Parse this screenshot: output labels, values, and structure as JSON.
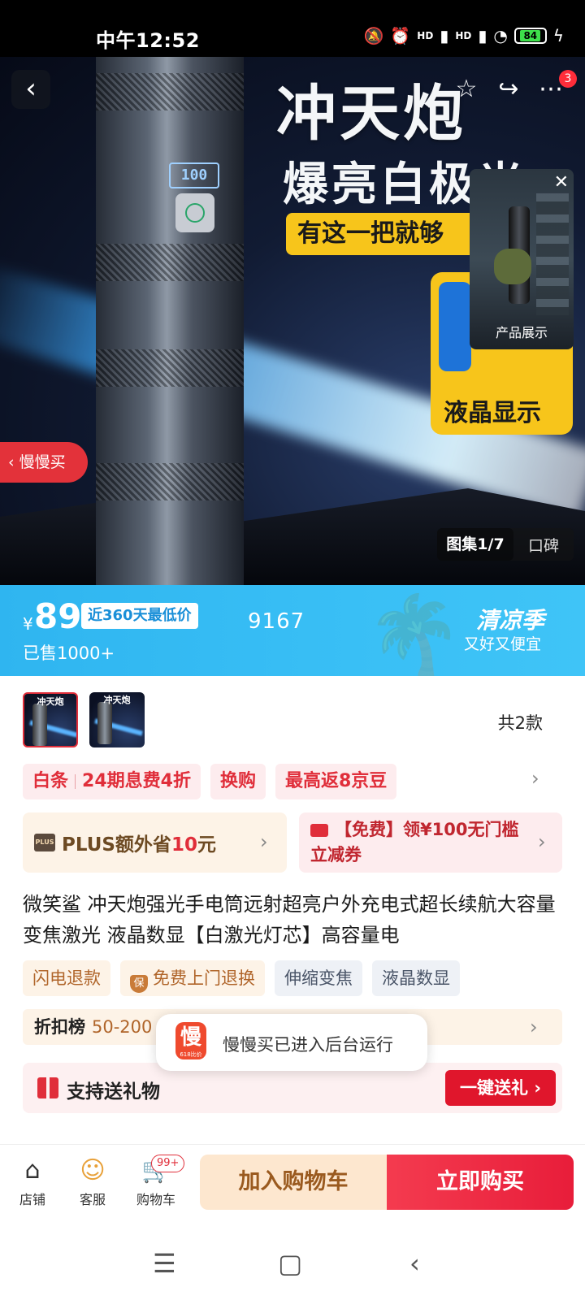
{
  "status_bar": {
    "time": "中午12:52",
    "sig1": "HD",
    "sig2": "HD",
    "battery": "84"
  },
  "hero": {
    "headline1": "冲天炮",
    "headline2": "爆亮白极光",
    "tag_yellow": "有这一把就够",
    "lcd_label": "液晶显示",
    "screen_readout": "100",
    "badge_count": "3",
    "video_caption": "产品展示",
    "manman_label": "慢慢买",
    "gallery": "图集1/7",
    "reviews": "口碑"
  },
  "price": {
    "currency": "¥",
    "value": "89",
    "lowest_label": "近360天最低价",
    "sold": "已售1000+",
    "code": "9167",
    "season_title": "清凉季",
    "season_sub": "又好又便宜"
  },
  "variants": {
    "thumb_text": "冲天炮",
    "count_label": "共2款"
  },
  "promos": [
    {
      "left": "白条",
      "right": "24期息费4折"
    },
    {
      "label": "换购"
    },
    {
      "label": "最高返8京豆"
    }
  ],
  "coupons": {
    "plus_logo": "PLUS",
    "plus_text": "PLUS额外省",
    "plus_amount": "10",
    "plus_unit": "元",
    "free_text": "【免费】领¥100无门槛立减券"
  },
  "product_title": "微笑鲨 冲天炮强光手电筒远射超亮户外充电式超长续航大容量变焦激光 液晶数显【白激光灯芯】高容量电",
  "service_tags": [
    "闪电退款",
    "免费上门退换",
    "伸缩变焦",
    "液晶数显"
  ],
  "rank": {
    "label": "折扣榜",
    "value": "50-200"
  },
  "toast": {
    "logo": "慢",
    "logo_sub": "618比价",
    "message": "慢慢买已进入后台运行"
  },
  "gift": {
    "label": "支持送礼物",
    "button": "一键送礼 ›"
  },
  "bottom_bar": {
    "shop": "店铺",
    "service": "客服",
    "cart": "购物车",
    "cart_badge": "99+",
    "add_to_cart": "加入购物车",
    "buy_now": "立即购买"
  },
  "colors": {
    "accent_red": "#e02e3a",
    "price_blue": "#2fb5f0",
    "cart_orange": "#fde7cf"
  }
}
